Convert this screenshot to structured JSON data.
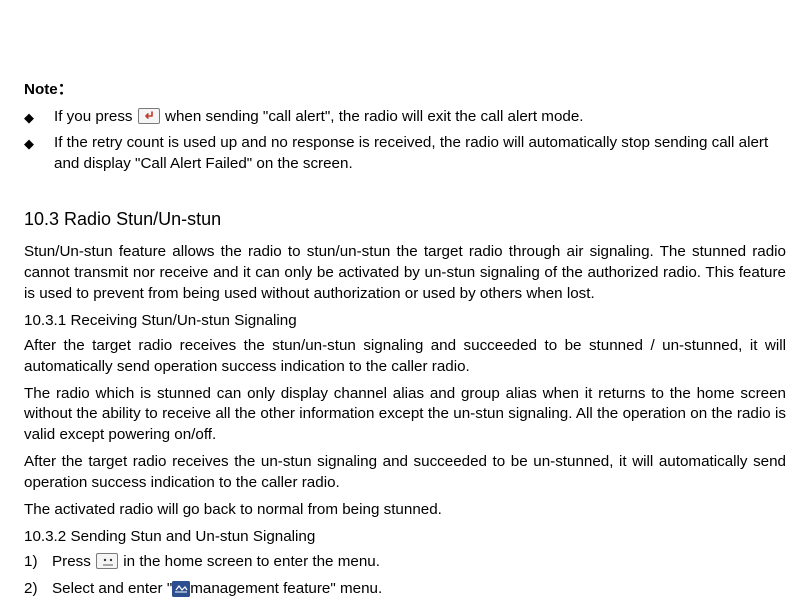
{
  "note": {
    "title": "Note：",
    "b1_pre": "If you press",
    "b1_post": " when sending \"call alert\", the radio will exit the call alert mode.",
    "b2": "If the retry count is used up and no response is received, the radio will automatically stop sending call alert and display \"Call Alert Failed\" on the screen."
  },
  "sec10_3": {
    "heading": "10.3    Radio Stun/Un-stun",
    "intro": "Stun/Un-stun feature allows the radio to stun/un-stun the target radio through air signaling. The stunned radio cannot transmit nor receive and it can only be activated by un-stun signaling of the authorized radio. This feature is used to prevent from being used without authorization or used by others when lost."
  },
  "sec10_3_1": {
    "heading": "10.3.1      Receiving Stun/Un-stun Signaling",
    "p1": "After the target radio receives the stun/un-stun signaling and succeeded to be stunned / un-stunned, it will automatically send operation success indication to the caller radio.",
    "p2": "The radio which is stunned can only display channel alias and group alias when it returns to the home screen without the ability to receive all the other information except the un-stun signaling. All the operation on the radio is valid except powering on/off.",
    "p3": "After the target radio receives the un-stun signaling and succeeded to be un-stunned, it will automatically send operation success indication to the caller radio.",
    "p4": "The activated radio will go back to normal from being stunned."
  },
  "sec10_3_2": {
    "heading": "10.3.2    Sending Stun and Un-stun Signaling",
    "n1_num": "1)",
    "n1_pre": "Press ",
    "n1_post": " in the home screen to enter the menu.",
    "n2_num": "2)",
    "n2_pre": "Select and enter \"",
    "n2_post": "management feature\" menu."
  },
  "bullet": "◆"
}
